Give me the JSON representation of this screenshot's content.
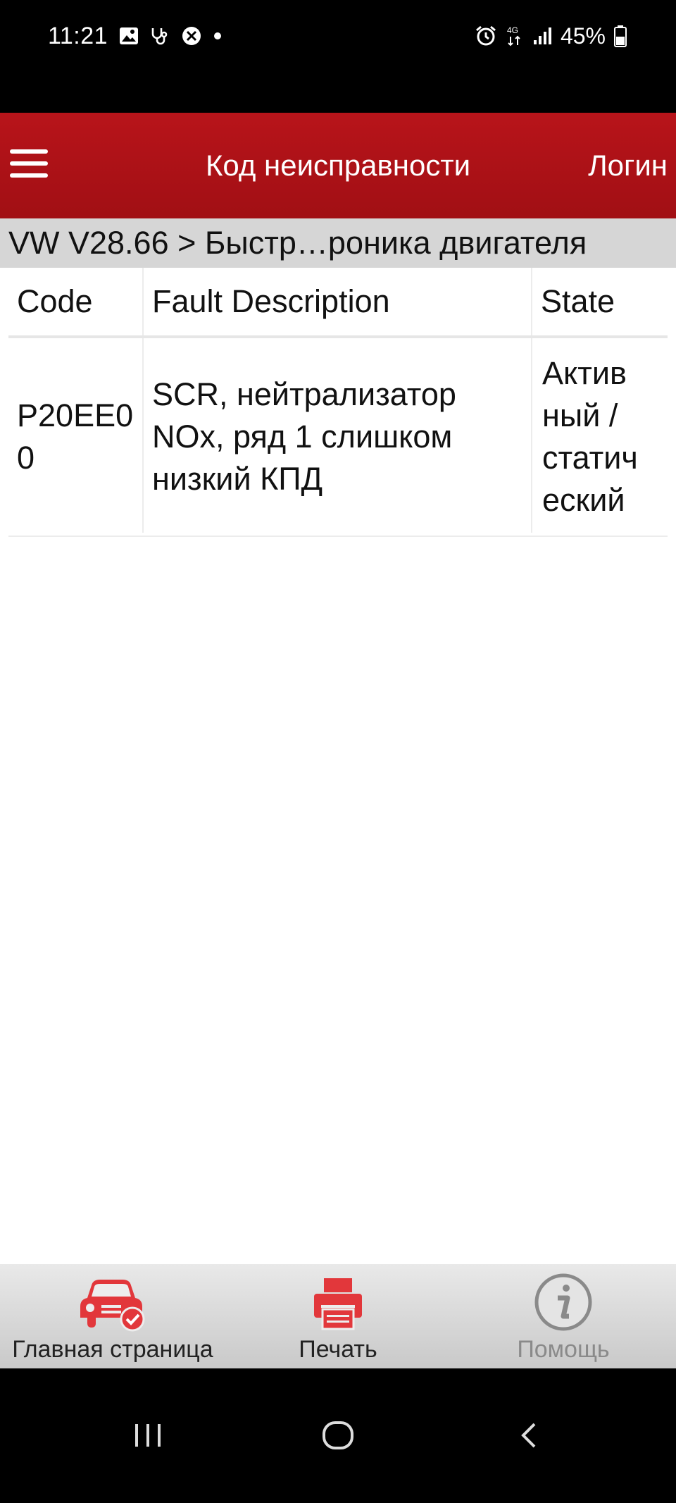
{
  "status_bar": {
    "time": "11:21",
    "battery": "45%",
    "network": "4G"
  },
  "app_bar": {
    "title": "Код неисправности",
    "login": "Логин"
  },
  "breadcrumb": "VW V28.66 > Быстр…роника двигателя",
  "table": {
    "headers": {
      "code": "Code",
      "description": "Fault Description",
      "state": "State"
    },
    "rows": [
      {
        "code": "P20EE00",
        "description": "SCR, нейтрализатор NOx, ряд 1 слишком низкий КПД",
        "state": "Актив ный / статич еский"
      }
    ]
  },
  "bottom_nav": {
    "home": "Главная страница",
    "print": "Печать",
    "help": "Помощь"
  },
  "colors": {
    "accent": "#b0121a",
    "icon_red": "#e2373b",
    "disabled": "#8a8a8a"
  }
}
